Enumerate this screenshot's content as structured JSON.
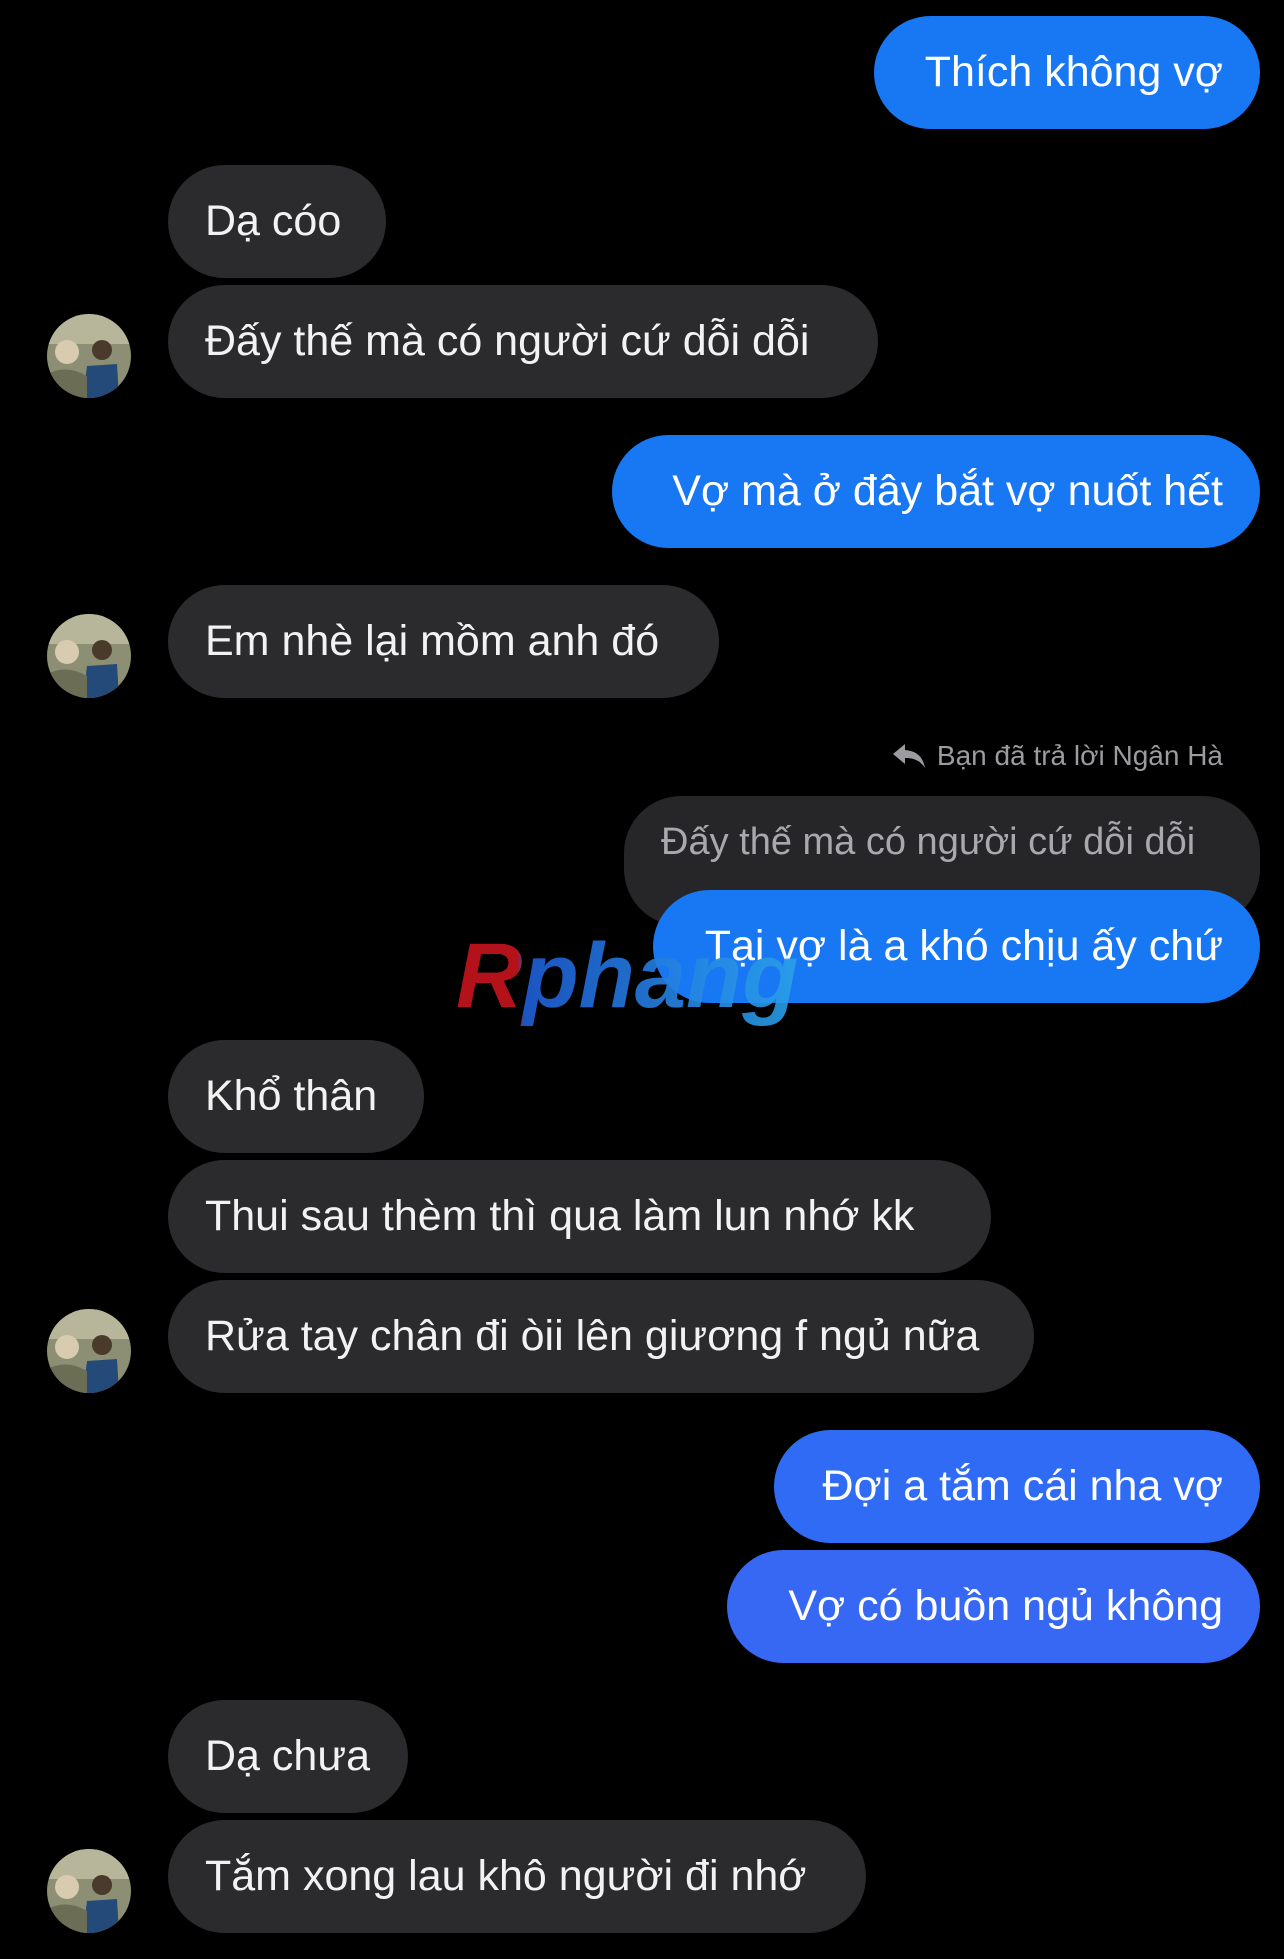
{
  "messages": {
    "m1": "Thích không vợ",
    "m2": "Dạ cóo",
    "m3": "Đấy thế mà có người cứ dỗi dỗi",
    "m4": "Vợ mà ở đây bắt vợ nuốt hết",
    "m5": "Em nhè lại mồm anh đó",
    "reply_note": "Bạn đã trả lời Ngân Hà",
    "quoted": "Đấy thế mà có người cứ dỗi dỗi",
    "m6": "Tại vợ là a khó chịu ấy chứ",
    "m7": "Khổ thân",
    "m8": "Thui sau thèm thì qua làm lun nhớ kk",
    "m9": "Rửa tay chân đi òii lên giương f ngủ nữa",
    "m10": "Đợi a tắm cái nha vợ",
    "m11": "Vợ có buồn ngủ không",
    "m12": "Dạ chưa",
    "m13": "Tắm xong lau khô người đi nhớ"
  },
  "watermark": "Rphang",
  "colors": {
    "background": "#000000",
    "incoming_bubble": "#2b2b2d",
    "outgoing_bubble": "#1877f2",
    "quoted_bubble": "#262628"
  },
  "icons": [
    "reply-arrow-icon",
    "avatar"
  ]
}
